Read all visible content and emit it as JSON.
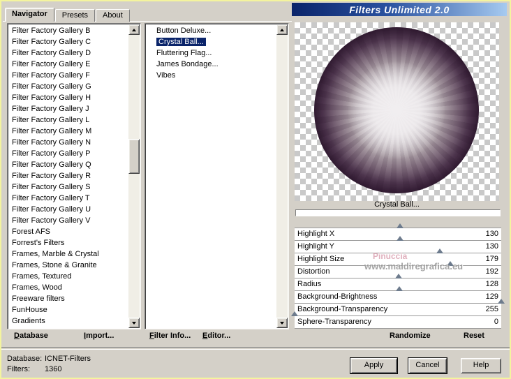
{
  "window": {
    "title": "Filters Unlimited 2.0"
  },
  "tabs": [
    {
      "label": "Navigator",
      "active": true
    },
    {
      "label": "Presets",
      "active": false
    },
    {
      "label": "About",
      "active": false
    }
  ],
  "categories": {
    "items": [
      "Filter Factory Gallery B",
      "Filter Factory Gallery C",
      "Filter Factory Gallery D",
      "Filter Factory Gallery E",
      "Filter Factory Gallery F",
      "Filter Factory Gallery G",
      "Filter Factory Gallery H",
      "Filter Factory Gallery J",
      "Filter Factory Gallery L",
      "Filter Factory Gallery M",
      "Filter Factory Gallery N",
      "Filter Factory Gallery P",
      "Filter Factory Gallery Q",
      "Filter Factory Gallery R",
      "Filter Factory Gallery S",
      "Filter Factory Gallery T",
      "Filter Factory Gallery U",
      "Filter Factory Gallery V",
      "Forest AFS",
      "Forrest's Filters",
      "Frames, Marble & Crystal",
      "Frames, Stone & Granite",
      "Frames, Textured",
      "Frames, Wood",
      "Freeware filters",
      "FunHouse",
      "Gradients"
    ]
  },
  "filters": {
    "items": [
      {
        "label": "Button Deluxe...",
        "selected": false
      },
      {
        "label": "Crystal Ball...",
        "selected": true
      },
      {
        "label": "Fluttering Flag...",
        "selected": false
      },
      {
        "label": "James Bondage...",
        "selected": false
      },
      {
        "label": "Vibes",
        "selected": false
      }
    ]
  },
  "preview": {
    "caption": "Crystal Ball..."
  },
  "params": {
    "max": 255,
    "rows": [
      {
        "label": "Highlight X",
        "value": 130
      },
      {
        "label": "Highlight Y",
        "value": 130
      },
      {
        "label": "Highlight Size",
        "value": 179
      },
      {
        "label": "Distortion",
        "value": 192
      },
      {
        "label": "Radius",
        "value": 128
      },
      {
        "label": "Background-Brightness",
        "value": 129
      },
      {
        "label": "Background-Transparency",
        "value": 255
      },
      {
        "label": "Sphere-Transparency",
        "value": 0
      }
    ]
  },
  "watermark": {
    "line1": "Pinuccia",
    "line2": "www.maldiregrafica.eu"
  },
  "toolbar": {
    "database": "Database",
    "import": "Import...",
    "filter_info": "Filter Info...",
    "editor": "Editor...",
    "randomize": "Randomize",
    "reset": "Reset"
  },
  "status": {
    "database_label": "Database:",
    "database_value": "ICNET-Filters",
    "filters_label": "Filters:",
    "filters_value": "1360"
  },
  "actions": {
    "apply": "Apply",
    "cancel": "Cancel",
    "help": "Help"
  },
  "colors": {
    "dialog_bg": "#d4d0c8",
    "selection": "#0a246a",
    "title_gradient_start": "#0a246a",
    "title_gradient_end": "#a6caf0",
    "watermark_pink": "#dba3b2",
    "border_yellow": "#f4f49e"
  }
}
